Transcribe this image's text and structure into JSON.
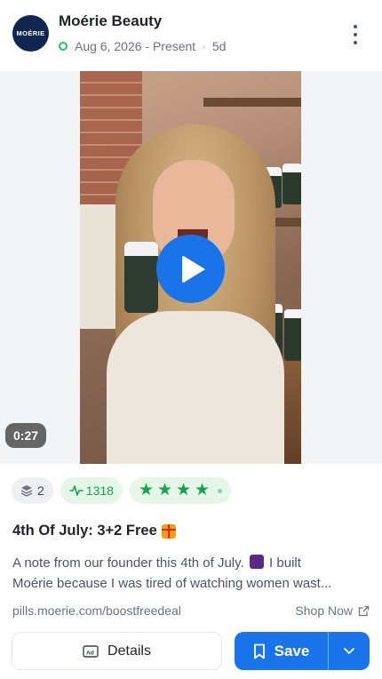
{
  "header": {
    "logo_text": "MOÉRIE",
    "brand_name": "Moérie Beauty",
    "date_range": "Aug 6, 2026 - Present",
    "separator": "·",
    "age": "5d"
  },
  "media": {
    "duration": "0:27"
  },
  "stats": {
    "variants": "2",
    "views": "1318",
    "rating_stars": 4
  },
  "ad": {
    "title": "4th Of July: 3+2 Free",
    "body_line1_a": "A note from our founder this 4th of July.",
    "body_line1_b": "I built",
    "body_line2": "Moérie because I was tired of watching women wast...",
    "url": "pills.moerie.com/boostfreedeal",
    "cta": "Shop Now"
  },
  "actions": {
    "details_label": "Details",
    "save_label": "Save"
  },
  "colors": {
    "accent": "#1a73e8",
    "positive": "#16a34a",
    "brand_logo_bg": "#0f2650"
  }
}
